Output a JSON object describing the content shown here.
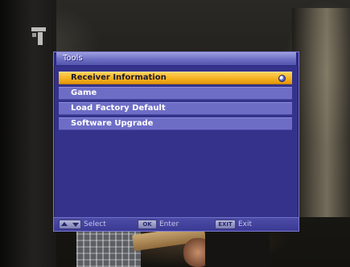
{
  "menu": {
    "title": "Tools",
    "items": [
      {
        "label": "Receiver Information",
        "selected": true
      },
      {
        "label": "Game",
        "selected": false
      },
      {
        "label": "Load Factory Default",
        "selected": false
      },
      {
        "label": "Software Upgrade",
        "selected": false
      }
    ],
    "selected_marker_icon": "radio-dot-icon"
  },
  "footer": {
    "select_key_icon": "up-down-arrow-icon",
    "select_label": "Select",
    "enter_key": "OK",
    "enter_label": "Enter",
    "exit_key": "EXIT",
    "exit_label": "Exit"
  },
  "channel_logo_icon": "channel-1-logo-icon",
  "colors": {
    "menu_background": "#34328a",
    "item_background": "#6e6dc6",
    "selected_item": "#f3ae1c",
    "title_bar": "#6d6fc4",
    "text": "#ffffff"
  }
}
